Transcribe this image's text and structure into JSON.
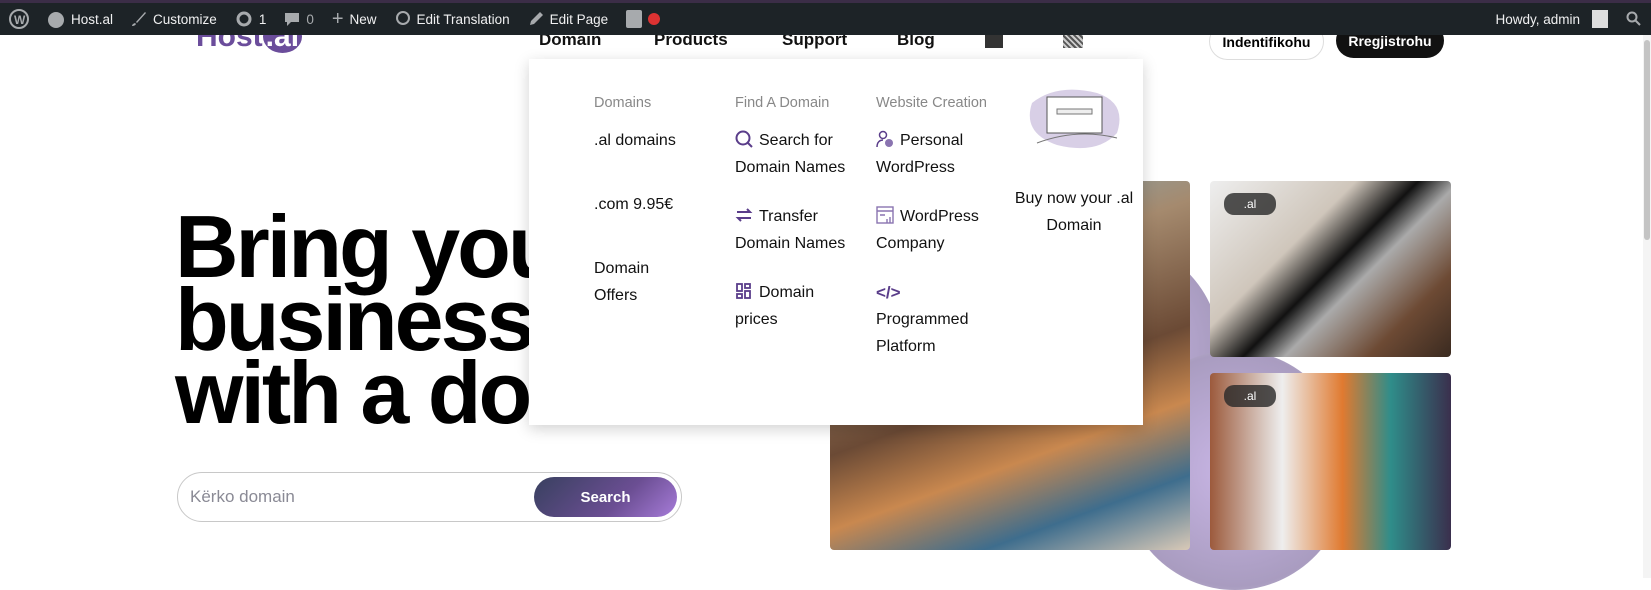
{
  "admin_bar": {
    "site": "Host.al",
    "customize": "Customize",
    "updates": "1",
    "comments": "0",
    "new": "New",
    "edit_translation": "Edit Translation",
    "edit_page": "Edit Page",
    "greeting": "Howdy, admin"
  },
  "header": {
    "logo": "Host.al",
    "nav": [
      "Domain",
      "Products",
      "Support",
      "Blog"
    ],
    "login": "Indentifikohu",
    "register": "Rregjistrohu"
  },
  "dropdown": {
    "col1": {
      "heading": "Domains",
      "items": [
        ".al domains",
        ".com 9.95€",
        "Domain Offers"
      ]
    },
    "col2": {
      "heading": "Find A Domain",
      "items": [
        "Search for Domain Names",
        "Transfer Domain Names",
        "Domain prices"
      ]
    },
    "col3": {
      "heading": "Website Creation",
      "items": [
        "Personal WordPress",
        "WordPress Company",
        "Programmed Platform"
      ]
    },
    "promo": "Buy now your .al Domain"
  },
  "hero": {
    "line1": "Bring your",
    "line2": "business to",
    "line3": "with a domain"
  },
  "search": {
    "placeholder": "Kërko domain",
    "button": "Search"
  },
  "images": {
    "tag1": ".al",
    "tag2": ".al"
  },
  "colors": {
    "accent": "#6b4d9b",
    "adminbar": "#1d2327"
  }
}
